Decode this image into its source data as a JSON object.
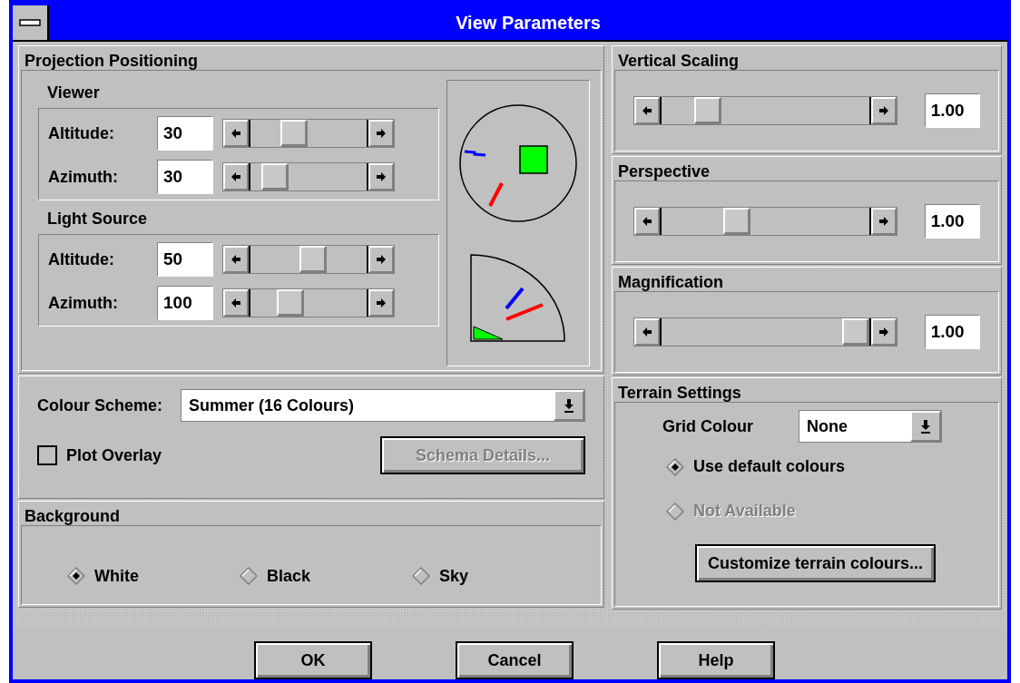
{
  "window": {
    "title": "View Parameters"
  },
  "projection_positioning": {
    "title": "Projection Positioning",
    "groups": [
      {
        "title": "Viewer",
        "rows": [
          {
            "label": "Altitude:",
            "value": "30"
          },
          {
            "label": "Azimuth:",
            "value": "30"
          }
        ]
      },
      {
        "title": "Light Source",
        "rows": [
          {
            "label": "Altitude:",
            "value": "50"
          },
          {
            "label": "Azimuth:",
            "value": "100"
          }
        ]
      }
    ]
  },
  "colour_scheme": {
    "label": "Colour Scheme:",
    "value": "Summer (16 Colours)",
    "plot_overlay": {
      "label": "Plot Overlay",
      "checked": false
    },
    "schema_details": {
      "label": "Schema Details...",
      "disabled": true
    }
  },
  "background": {
    "title": "Background",
    "options": [
      {
        "label": "White",
        "selected": true
      },
      {
        "label": "Black",
        "selected": false
      },
      {
        "label": "Sky",
        "selected": false
      }
    ]
  },
  "right_panels": [
    {
      "title": "Vertical Scaling",
      "value": "1.00"
    },
    {
      "title": "Perspective",
      "value": "1.00"
    },
    {
      "title": "Magnification",
      "value": "1.00"
    }
  ],
  "terrain_settings": {
    "title": "Terrain Settings",
    "grid_colour": {
      "label": "Grid Colour",
      "value": "None"
    },
    "options": [
      {
        "label": "Use default colours",
        "selected": true,
        "disabled": false
      },
      {
        "label": "Not Available",
        "selected": false,
        "disabled": true
      }
    ],
    "customize_button": "Customize terrain colours..."
  },
  "buttons": [
    "OK",
    "Cancel",
    "Help"
  ]
}
